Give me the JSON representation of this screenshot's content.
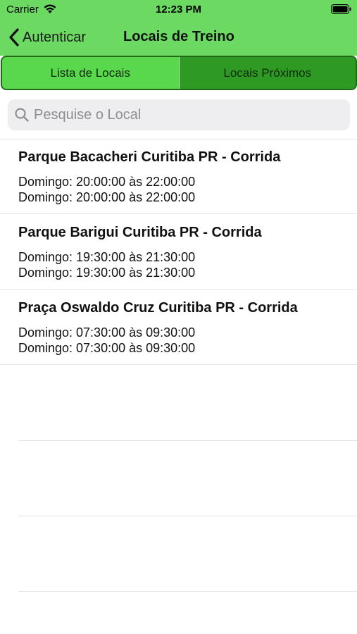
{
  "status_bar": {
    "carrier": "Carrier",
    "time": "12:23 PM"
  },
  "nav": {
    "back_label": "Autenticar",
    "title": "Locais de Treino"
  },
  "segments": [
    {
      "label": "Lista de Locais",
      "selected": false
    },
    {
      "label": "Locais Próximos",
      "selected": true
    }
  ],
  "search": {
    "placeholder": "Pesquise o Local",
    "value": ""
  },
  "locations": [
    {
      "title": "Parque Bacacheri Curitiba PR - Corrida",
      "schedule": [
        "Domingo: 20:00:00 às 22:00:00",
        "Domingo: 20:00:00 às 22:00:00"
      ]
    },
    {
      "title": "Parque Barigui Curitiba PR - Corrida",
      "schedule": [
        "Domingo: 19:30:00 às 21:30:00",
        "Domingo: 19:30:00 às 21:30:00"
      ]
    },
    {
      "title": "Praça Oswaldo Cruz Curitiba PR - Corrida",
      "schedule": [
        "Domingo: 07:30:00 às 09:30:00",
        "Domingo: 07:30:00 às 09:30:00"
      ]
    }
  ],
  "colors": {
    "header_bg": "#6cda62",
    "segment_selected": "#2e9a23",
    "segment_unselected": "#5ad84d",
    "segment_border": "#1e6b14"
  },
  "icons": {
    "wifi": "wifi-icon",
    "battery": "battery-icon",
    "back": "chevron-left-icon",
    "search": "search-icon"
  }
}
